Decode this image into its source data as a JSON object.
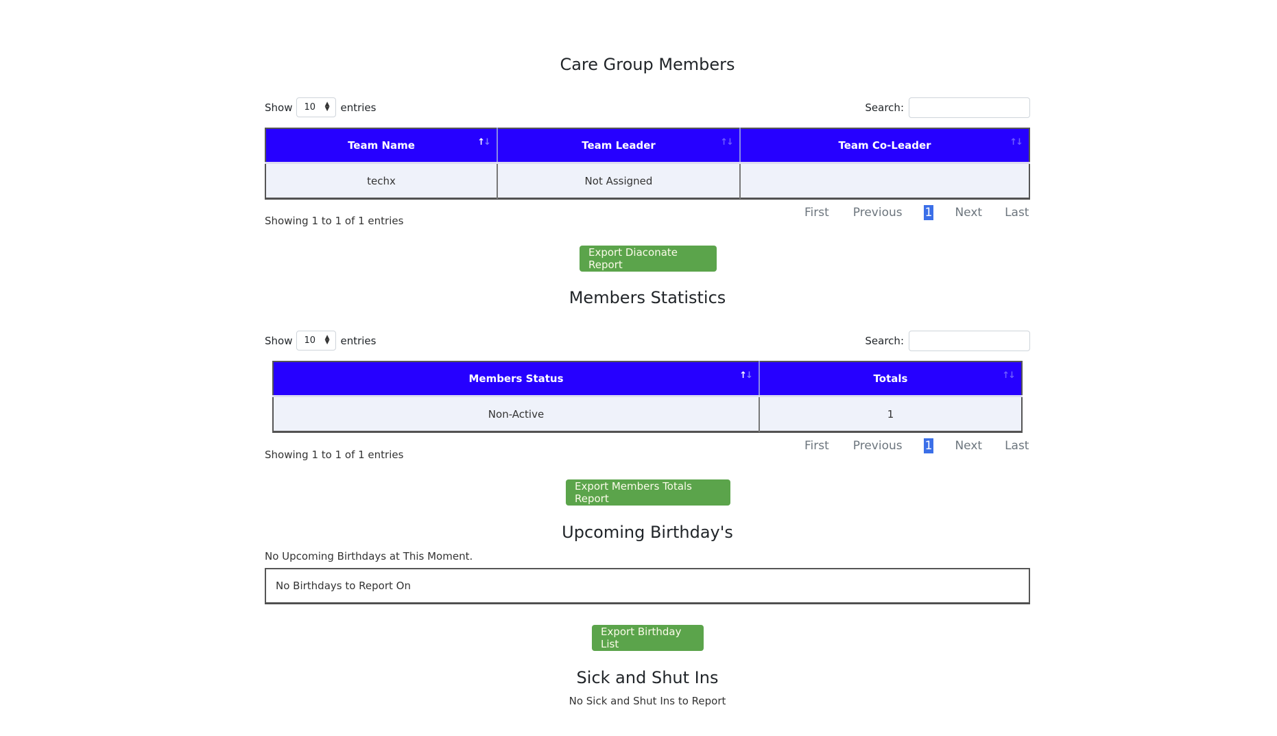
{
  "care_group": {
    "title": "Care Group Members",
    "length": {
      "show_label": "Show",
      "value": "10",
      "entries_label": "entries"
    },
    "search": {
      "label": "Search:",
      "value": "",
      "placeholder": ""
    },
    "columns": [
      "Team Name",
      "Team Leader",
      "Team Co-Leader"
    ],
    "rows": [
      [
        "techx",
        "Not Assigned",
        ""
      ]
    ],
    "info": "Showing 1 to 1 of 1 entries",
    "pagination": {
      "first": "First",
      "previous": "Previous",
      "current": "1",
      "next": "Next",
      "last": "Last"
    },
    "export_button": "Export Diaconate Report"
  },
  "members_statistics": {
    "title": "Members Statistics",
    "length": {
      "show_label": "Show",
      "value": "10",
      "entries_label": "entries"
    },
    "search": {
      "label": "Search:",
      "value": "",
      "placeholder": ""
    },
    "columns": [
      "Members Status",
      "Totals"
    ],
    "rows": [
      [
        "Non-Active",
        "1"
      ]
    ],
    "info": "Showing 1 to 1 of 1 entries",
    "pagination": {
      "first": "First",
      "previous": "Previous",
      "current": "1",
      "next": "Next",
      "last": "Last"
    },
    "export_button": "Export Members Totals Report"
  },
  "birthdays": {
    "title": "Upcoming Birthday's",
    "status": "No Upcoming Birthdays at This Moment.",
    "box_text": "No Birthdays to Report On",
    "export_button": "Export Birthday List"
  },
  "sick_shut_ins": {
    "title": "Sick and Shut Ins",
    "status": "No Sick and Shut Ins to Report"
  },
  "icons": {
    "sort_up": "↑",
    "sort_down": "↓",
    "select_up": "▲",
    "select_down": "▼"
  },
  "colors": {
    "table_header": "#2600ff",
    "table_row": "#eff2fa",
    "export_button": "#5ba44b",
    "pagination_current": "#3b6fe8"
  }
}
